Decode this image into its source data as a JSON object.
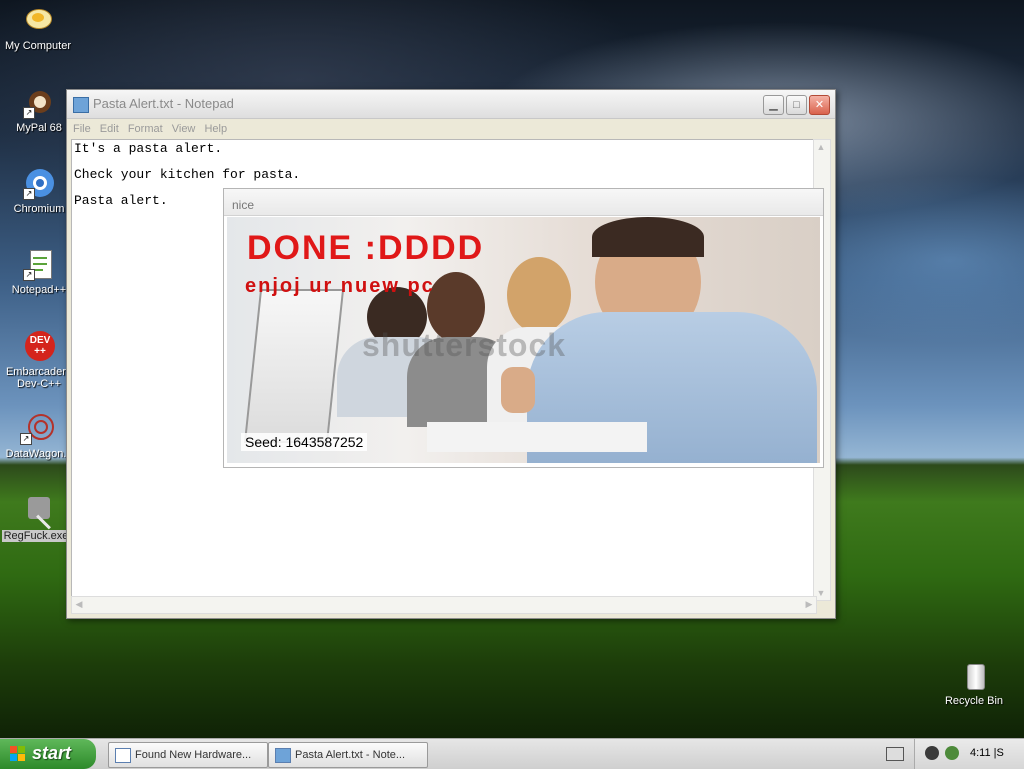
{
  "desktop": {
    "icons": [
      {
        "label": "My Computer"
      },
      {
        "label": "MyPal 68"
      },
      {
        "label": "Chromium"
      },
      {
        "label": "Notepad++"
      },
      {
        "label": "Embarcadero Dev-C++"
      },
      {
        "label": "DataWagon."
      },
      {
        "label": "RegFuck.exe"
      },
      {
        "label": "Recycle Bin"
      }
    ]
  },
  "notepad": {
    "title": "Pasta Alert.txt - Notepad",
    "menu": [
      "File",
      "Edit",
      "Format",
      "View",
      "Help"
    ],
    "lines": [
      "It's a pasta alert.",
      "Check your kitchen for pasta.",
      "Pasta alert."
    ]
  },
  "popup": {
    "title": "nice",
    "image_text": {
      "headline": "DONE :DDDD",
      "subline": "enjoj ur nuew pc",
      "watermark": "shutterstock",
      "seed": "Seed: 1643587252"
    }
  },
  "taskbar": {
    "start_label": "start",
    "tasks": [
      {
        "label": "Found New Hardware..."
      },
      {
        "label": "Pasta Alert.txt - Note..."
      }
    ],
    "clock": "4:11 |S"
  }
}
